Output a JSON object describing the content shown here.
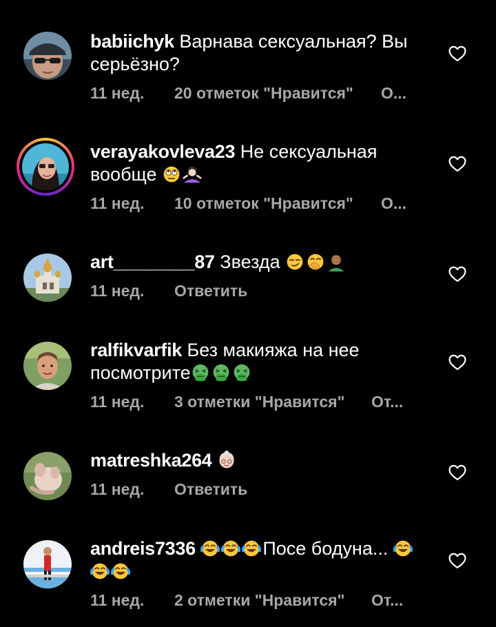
{
  "comments": [
    {
      "username": "babiichyk",
      "text": "Варнава сексуальная? Вы серьёзно?",
      "time": "11 нед.",
      "likes": "20 отметок \"Нравится\"",
      "reply": "О..."
    },
    {
      "username": "verayakovleva23",
      "text": "Не сексуальная вообще",
      "time": "11 нед.",
      "likes": "10 отметок \"Нравится\"",
      "reply": "О..."
    },
    {
      "username": "art________87",
      "text": "Звезда",
      "time": "11 нед.",
      "reply": "Ответить"
    },
    {
      "username": "ralfikvarfik",
      "text": "Без макияжа на нее посмотрите",
      "time": "11 нед.",
      "likes": "3 отметки \"Нравится\"",
      "reply": "От..."
    },
    {
      "username": "matreshka264",
      "text": "",
      "time": "11 нед.",
      "reply": "Ответить"
    },
    {
      "username": "andreis7336",
      "text": "Посе бодуна...",
      "time": "11 нед.",
      "likes": "2 отметки \"Нравится\"",
      "reply": "От..."
    }
  ],
  "icons": {
    "like": "heart-outline-icon",
    "emoji_roll": "face-with-rolling-eyes-emoji",
    "emoji_shrug": "woman-shrugging-emoji",
    "emoji_smirk": "smirking-face-emoji",
    "emoji_hug": "face-with-hand-over-mouth-emoji",
    "emoji_facepalm": "man-facepalming-emoji",
    "emoji_vomit": "face-vomiting-emoji",
    "emoji_old": "old-woman-emoji",
    "emoji_laugh": "face-with-tears-of-joy-emoji"
  },
  "colors": {
    "background": "#000000",
    "text": "#ffffff",
    "meta": "#a8a8a8"
  }
}
